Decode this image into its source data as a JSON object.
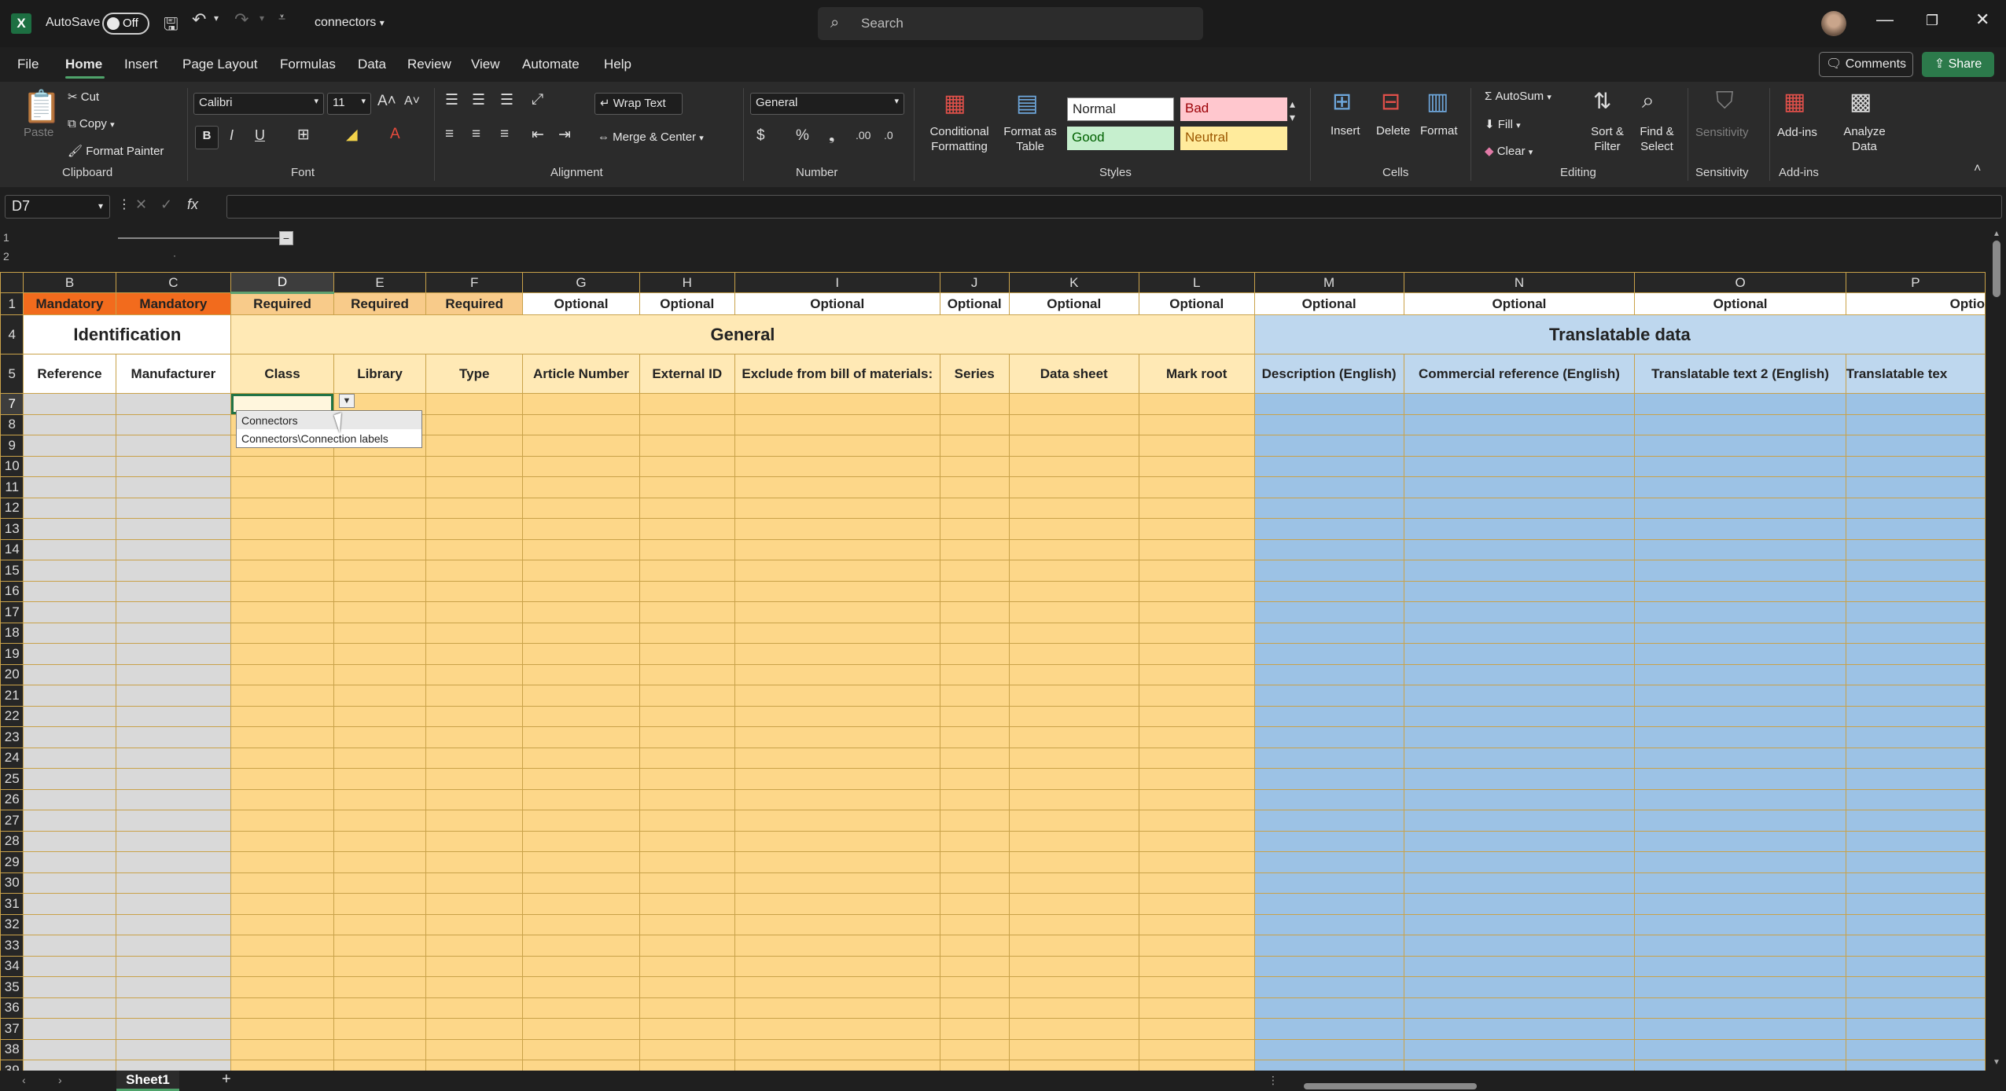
{
  "titlebar": {
    "autosave_label": "AutoSave",
    "autosave_state": "Off",
    "filename": "connectors",
    "search_placeholder": "Search"
  },
  "menu": {
    "tabs": [
      "File",
      "Home",
      "Insert",
      "Page Layout",
      "Formulas",
      "Data",
      "Review",
      "View",
      "Automate",
      "Help"
    ],
    "active_tab": "Home",
    "comments_label": "Comments",
    "share_label": "Share"
  },
  "ribbon": {
    "clipboard": {
      "paste": "Paste",
      "cut": "Cut",
      "copy": "Copy",
      "format_painter": "Format Painter",
      "label": "Clipboard"
    },
    "font": {
      "name": "Calibri",
      "size": "11",
      "label": "Font"
    },
    "alignment": {
      "wrap_text": "Wrap Text",
      "merge_center": "Merge & Center",
      "label": "Alignment"
    },
    "number": {
      "format": "General",
      "label": "Number"
    },
    "styles": {
      "conditional_formatting": "Conditional Formatting",
      "format_as_table": "Format as Table",
      "normal": "Normal",
      "bad": "Bad",
      "good": "Good",
      "neutral": "Neutral",
      "label": "Styles"
    },
    "cells": {
      "insert": "Insert",
      "delete": "Delete",
      "format": "Format",
      "label": "Cells"
    },
    "editing": {
      "autosum": "AutoSum",
      "fill": "Fill",
      "clear": "Clear",
      "sort_filter": "Sort & Filter",
      "find_select": "Find & Select",
      "label": "Editing"
    },
    "sensitivity": {
      "button": "Sensitivity",
      "label": "Sensitivity"
    },
    "addins": {
      "addins": "Add-ins",
      "analyze": "Analyze Data",
      "label": "Add-ins"
    }
  },
  "formula_bar": {
    "name_box": "D7",
    "fx": "fx"
  },
  "grid": {
    "columns": [
      "B",
      "C",
      "D",
      "E",
      "F",
      "G",
      "H",
      "I",
      "J",
      "K",
      "L",
      "M",
      "N",
      "O",
      "P"
    ],
    "selected_column": "D",
    "row1": [
      "Mandatory",
      "Mandatory",
      "Required",
      "Required",
      "Required",
      "Optional",
      "Optional",
      "Optional",
      "Optional",
      "Optional",
      "Optional",
      "Optional",
      "Optional",
      "Optional",
      "Optio"
    ],
    "sections": {
      "identification": "Identification",
      "general": "General",
      "translatable": "Translatable data"
    },
    "headers": [
      "Reference",
      "Manufacturer",
      "Class",
      "Library",
      "Type",
      "Article Number",
      "External ID",
      "Exclude from bill of materials:",
      "Series",
      "Data sheet",
      "Mark root",
      "Description (English)",
      "Commercial reference (English)",
      "Translatable text 2 (English)",
      "Translatable tex"
    ],
    "body_rows": [
      "7",
      "8",
      "9",
      "10",
      "11",
      "12",
      "13",
      "14",
      "15",
      "16",
      "17",
      "18",
      "19",
      "20",
      "21",
      "22",
      "23",
      "24",
      "25",
      "26",
      "27",
      "28",
      "29",
      "30",
      "31",
      "32",
      "33",
      "34",
      "35",
      "36",
      "37",
      "38",
      "39"
    ],
    "top_rows": [
      "1",
      "4",
      "5"
    ],
    "outline_rows": [
      "1",
      "2"
    ]
  },
  "dropdown": {
    "items": [
      "Connectors",
      "Connectors\\Connection labels"
    ],
    "highlighted": "Connectors"
  },
  "sheetbar": {
    "tab": "Sheet1"
  },
  "colors": {
    "mandatory": "#f26b1d",
    "required": "#f8cb8a",
    "general_fill": "#fdd789",
    "translatable_fill": "#9cc2e5",
    "accent": "#4fa36b"
  }
}
